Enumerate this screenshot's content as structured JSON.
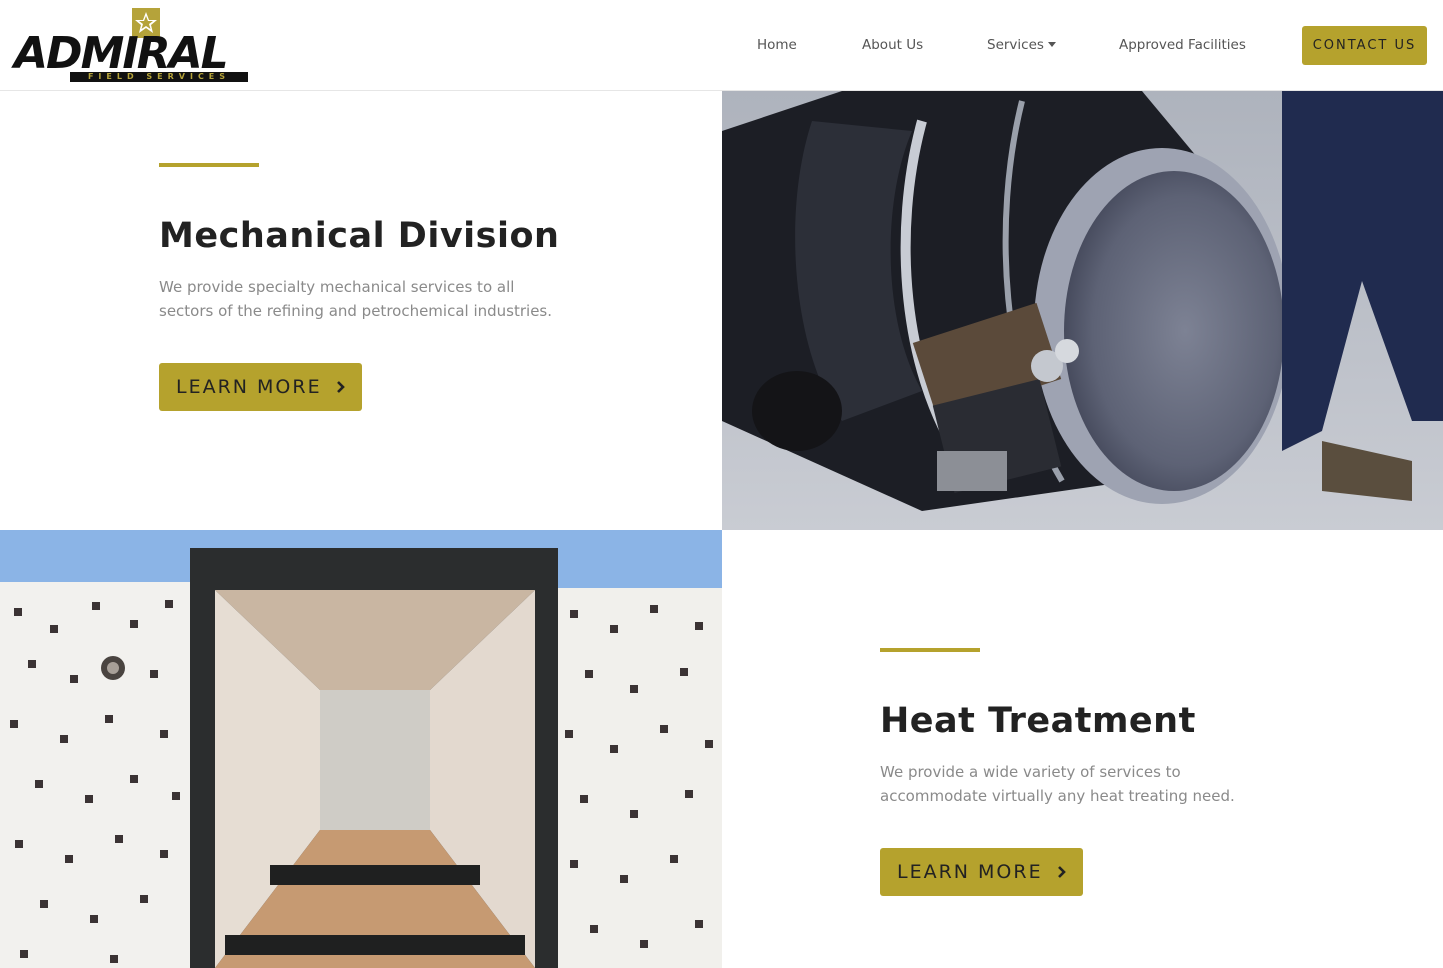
{
  "brand": {
    "name": "ADMIRAL",
    "tagline": "FIELD SERVICES",
    "accent_color": "#b5a22d",
    "logo_icon": "star-logo-icon"
  },
  "nav": {
    "items": [
      {
        "label": "Home"
      },
      {
        "label": "About Us"
      },
      {
        "label": "Services",
        "has_dropdown": true
      },
      {
        "label": "Approved Facilities"
      }
    ],
    "contact_label": "CONTACT US"
  },
  "sections": [
    {
      "title": "Mechanical Division",
      "text": "We provide specialty mechanical services to all sectors of the refining and petrochemical industries.",
      "button_label": "LEARN MORE",
      "image": "pipe-cutting-machine-photo"
    },
    {
      "title": "Heat Treatment",
      "text": "We provide a wide variety of services to accommodate virtually any heat treating need.",
      "button_label": "LEARN MORE",
      "image": "heat-treatment-furnace-photo"
    }
  ]
}
